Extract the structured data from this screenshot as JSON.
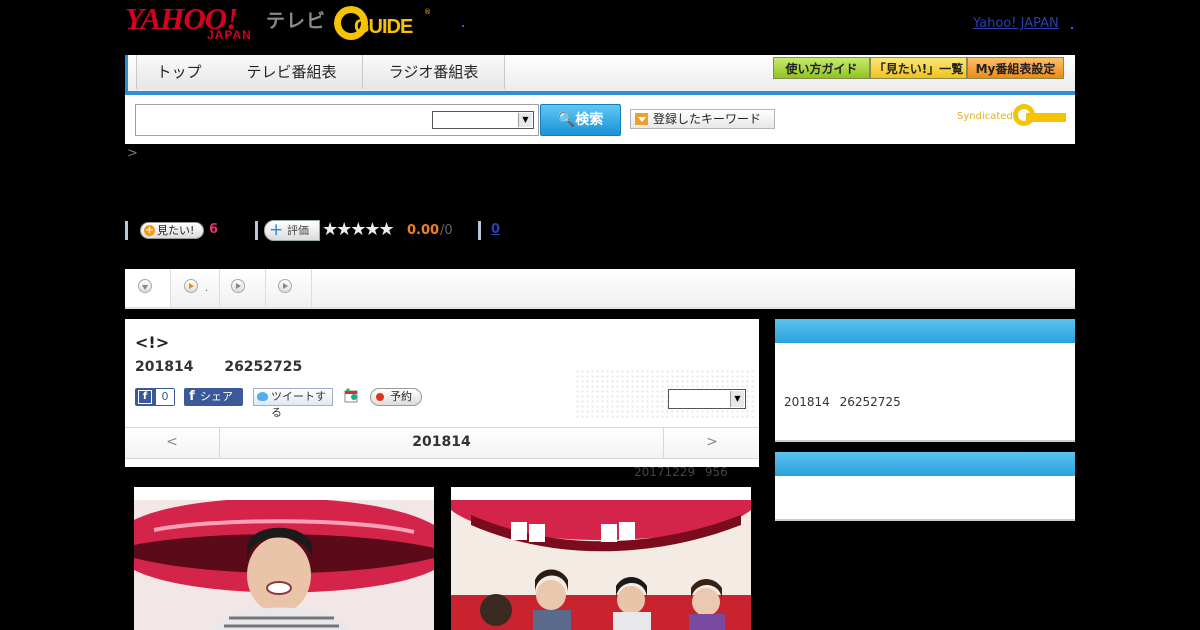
{
  "header": {
    "yahoo_logo_text": "YAHOO!",
    "yahoo_logo_sub": "JAPAN",
    "tv_label": "テレビ",
    "gguide_logo_text": "GUIDE",
    "gguide_reg_mark": "®",
    "top_link": "Yahoo! JAPAN"
  },
  "nav": {
    "tabs": [
      "トップ",
      "テレビ番組表",
      "ラジオ番組表"
    ],
    "buttons": [
      {
        "label": "使い方ガイド",
        "color": "#a6d53a"
      },
      {
        "label": "「見たい!」一覧",
        "color": "#f3d23a"
      },
      {
        "label": "My番組表設定",
        "color": "#f39a2a"
      }
    ]
  },
  "search": {
    "input_value": "",
    "select_value": "",
    "button_label": "検索",
    "keyword_button": "登録したキーワード",
    "syndicated": "Syndicated"
  },
  "breadcrumb": ">",
  "ratings": {
    "want_label": "見たい!",
    "want_count": "6",
    "rate_label": "評価",
    "stars": "★★★★★",
    "score": "0.00",
    "score_den": "/0",
    "comments": "0"
  },
  "program": {
    "title": "<!>",
    "date": "201814 26252725",
    "fb_like_count": "0",
    "fb_share": "シェア",
    "tweet": "ツイートする",
    "reserve": "予約",
    "channel_select": "",
    "day_prev": "<",
    "day_label": "201814",
    "day_next": ">",
    "updated": "20171229 956"
  },
  "sidebar": {
    "box1_text": "201814 26252725"
  },
  "colors": {
    "accent": "#2e8fd8",
    "yahoo_red": "#d4001e",
    "gguide_yellow": "#f4c400"
  }
}
